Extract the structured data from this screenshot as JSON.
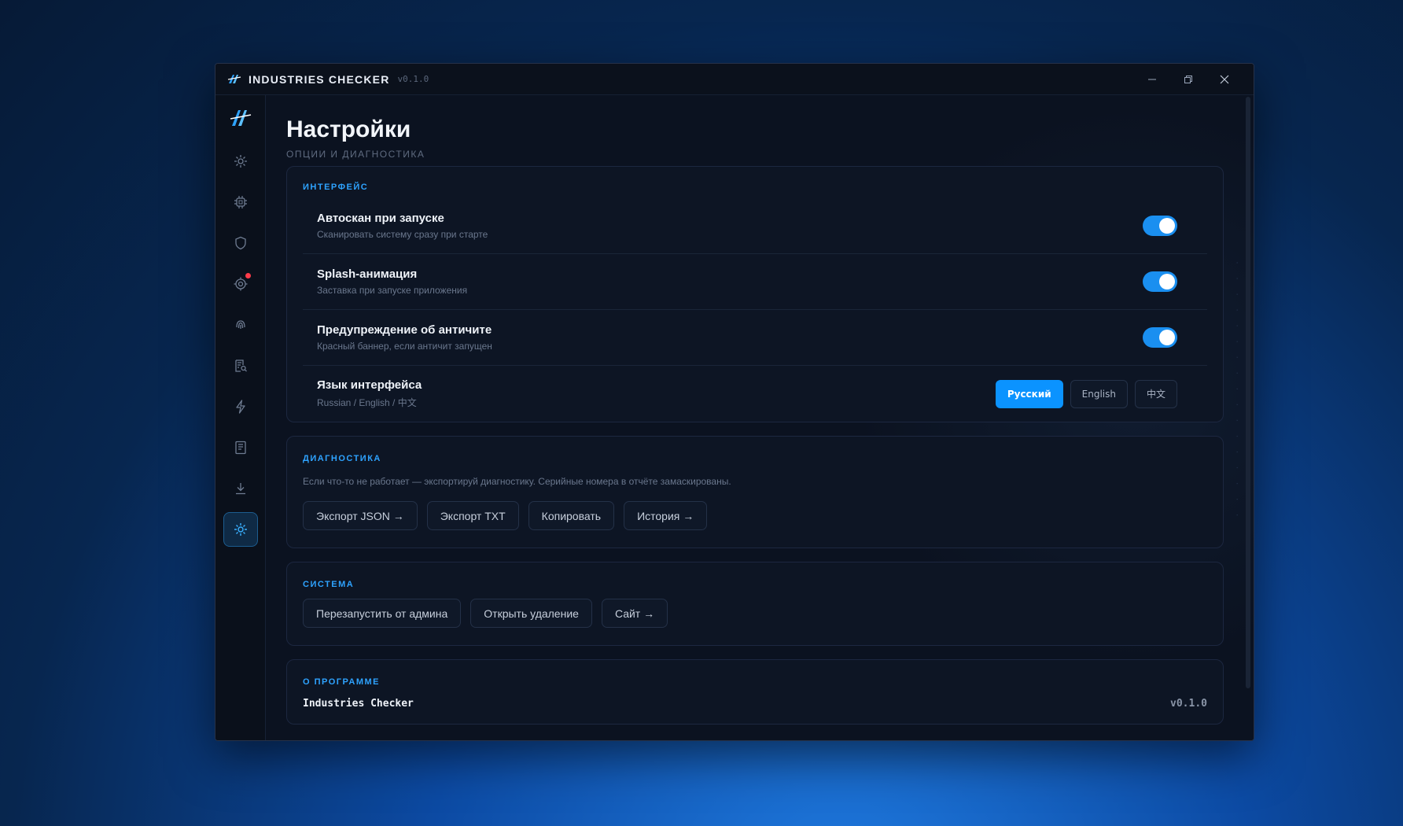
{
  "app": {
    "title": "INDUSTRIES CHECKER",
    "version": "v0.1.0"
  },
  "window_controls": [
    "minimize",
    "maximize",
    "close"
  ],
  "sidebar": {
    "items": [
      {
        "icon": "dashboard-icon"
      },
      {
        "icon": "cpu-icon"
      },
      {
        "icon": "shield-icon"
      },
      {
        "icon": "target-icon",
        "notification": true
      },
      {
        "icon": "fingerprint-icon"
      },
      {
        "icon": "report-search-icon"
      },
      {
        "icon": "lightning-icon"
      },
      {
        "icon": "document-icon"
      },
      {
        "icon": "download-icon"
      },
      {
        "icon": "settings-icon",
        "active": true
      }
    ]
  },
  "page": {
    "title": "Настройки",
    "subtitle": "ОПЦИИ И ДИАГНОСТИКА"
  },
  "interface": {
    "title": "ИНТЕРФЕЙС",
    "rows": [
      {
        "label": "Автоскан при запуске",
        "desc": "Сканировать систему сразу при старте",
        "enabled": true
      },
      {
        "label": "Splash-анимация",
        "desc": "Заставка при запуске приложения",
        "enabled": true
      },
      {
        "label": "Предупреждение об античите",
        "desc": "Красный баннер, если античит запущен",
        "enabled": true
      }
    ],
    "language": {
      "label": "Язык интерфейса",
      "desc": "Russian / English / 中文",
      "options": [
        "Русский",
        "English",
        "中文"
      ],
      "selected": "Русский"
    }
  },
  "diagnostics": {
    "title": "ДИАГНОСТИКА",
    "desc": "Если что-то не работает — экспортируй диагностику. Серийные номера в отчёте замаскированы.",
    "buttons": [
      "Экспорт JSON →",
      "Экспорт TXT",
      "Копировать",
      "История →"
    ]
  },
  "system": {
    "title": "СИСТЕМА",
    "buttons": [
      "Перезапустить от админа",
      "Открыть удаление",
      "Сайт →"
    ]
  },
  "about": {
    "title": "О ПРОГРАММЕ",
    "name": "Industries Checker",
    "version": "v0.1.0"
  },
  "colors": {
    "accent": "#1a8ff0",
    "section_title": "#2ea3ff",
    "badge": "#ff3b4a"
  }
}
